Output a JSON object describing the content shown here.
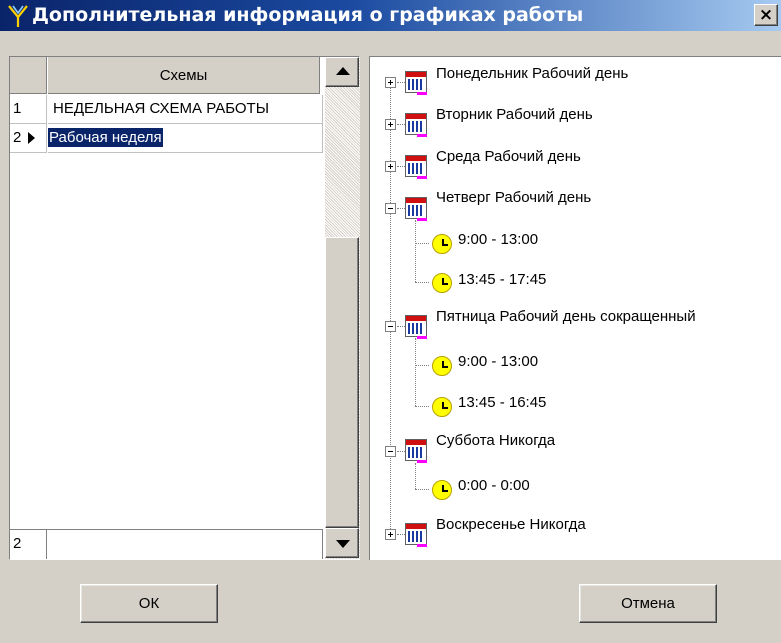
{
  "window": {
    "title": "Дополнительная информация о графиках работы",
    "close_label": "×"
  },
  "grid": {
    "column_header": "Схемы",
    "rows": [
      {
        "num": "1",
        "name": "НЕДЕЛЬНАЯ СХЕМА РАБОТЫ"
      },
      {
        "num": "2",
        "name": "Рабочая неделя"
      }
    ],
    "footer_num": "2"
  },
  "tree": {
    "days": [
      {
        "label": "Понедельник Рабочий день",
        "expanded": false,
        "intervals": []
      },
      {
        "label": "Вторник Рабочий день",
        "expanded": false,
        "intervals": []
      },
      {
        "label": "Среда Рабочий день",
        "expanded": false,
        "intervals": []
      },
      {
        "label": "Четверг Рабочий день",
        "expanded": true,
        "intervals": [
          "9:00 - 13:00",
          "13:45 - 17:45"
        ]
      },
      {
        "label": "Пятница Рабочий день сокращенный",
        "expanded": true,
        "intervals": [
          "9:00 - 13:00",
          "13:45 - 16:45"
        ]
      },
      {
        "label": "Суббота Никогда",
        "expanded": true,
        "intervals": [
          "0:00 - 0:00"
        ]
      },
      {
        "label": "Воскресенье Никогда",
        "expanded": false,
        "intervals": []
      }
    ]
  },
  "buttons": {
    "ok_label": "ОК",
    "cancel_label": "Отмена"
  },
  "colors": {
    "titlebar": "#0a246a",
    "selection": "#0a246a",
    "face": "#d4d0c8"
  }
}
